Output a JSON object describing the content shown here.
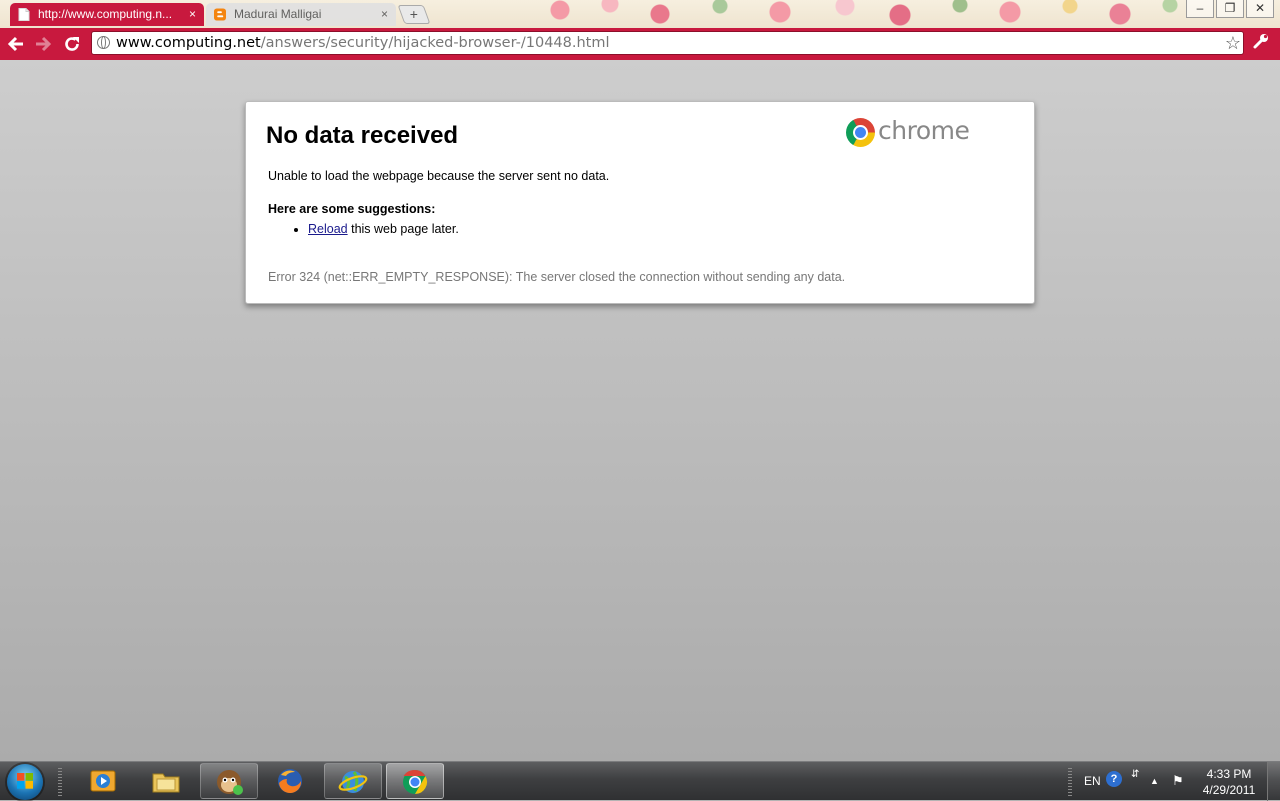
{
  "browser": {
    "tabs": [
      {
        "title": "http://www.computing.n...",
        "active": true,
        "icon": "page-icon"
      },
      {
        "title": "Madurai Malligai",
        "active": false,
        "icon": "blogger-icon"
      }
    ],
    "tab_close_glyph": "×",
    "new_tab_glyph": "+",
    "window_controls": [
      "–",
      "❐",
      "✕"
    ],
    "address": {
      "domain": "www.computing.net",
      "path": "/answers/security/hijacked-browser-/10448.html"
    },
    "accent_color": "#c8193e"
  },
  "error_page": {
    "title": "No data received",
    "brand_word": "chrome",
    "description": "Unable to load the webpage because the server sent no data.",
    "suggestions_heading": "Here are some suggestions:",
    "suggestion_link": "Reload",
    "suggestion_rest": " this web page later.",
    "error_code": "Error 324 (net::ERR_EMPTY_RESPONSE): The server closed the connection without sending any data."
  },
  "taskbar": {
    "pinned": [
      "media-player-icon",
      "explorer-icon",
      "monkey-app-icon",
      "firefox-icon",
      "globe-app-icon",
      "chrome-icon"
    ],
    "tray": {
      "language": "EN",
      "help": "?"
    },
    "clock": {
      "time": "4:33 PM",
      "date": "4/29/2011"
    }
  }
}
